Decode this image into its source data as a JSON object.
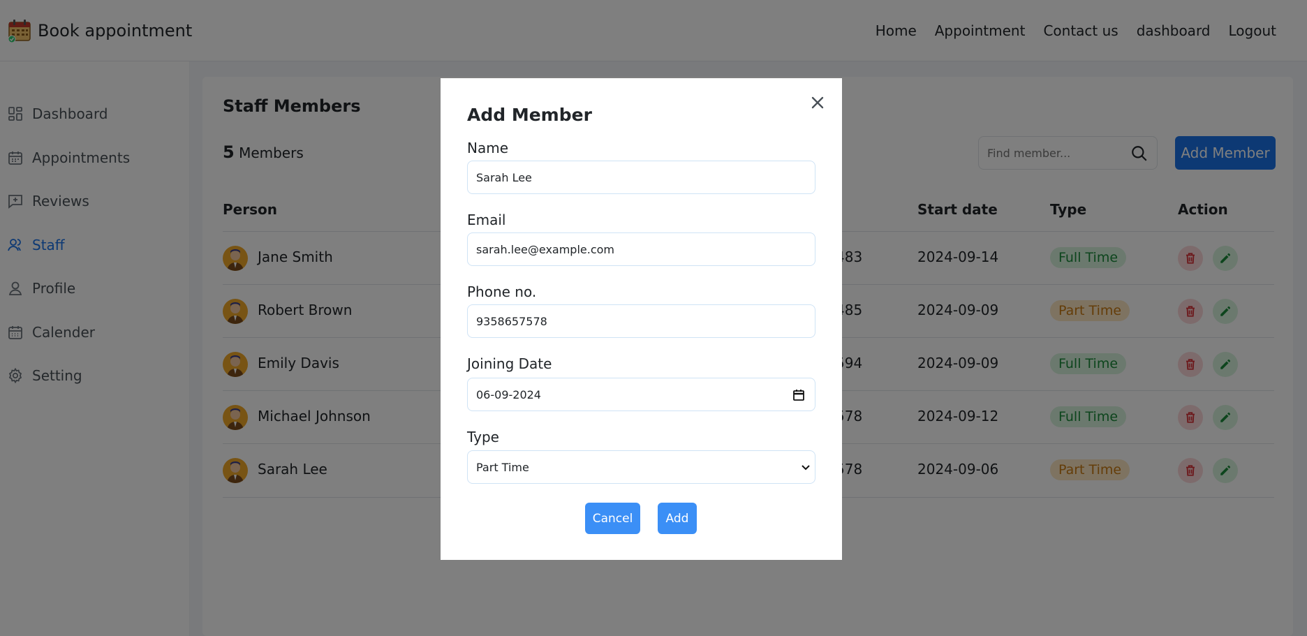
{
  "app": {
    "title": "Book appointment"
  },
  "nav": [
    "Home",
    "Appointment",
    "Contact us",
    "dashboard",
    "Logout"
  ],
  "sidebar": {
    "items": [
      {
        "label": "Dashboard",
        "icon": "dashboard-icon"
      },
      {
        "label": "Appointments",
        "icon": "calendar-icon"
      },
      {
        "label": "Reviews",
        "icon": "review-icon"
      },
      {
        "label": "Staff",
        "icon": "staff-icon",
        "active": true
      },
      {
        "label": "Profile",
        "icon": "user-icon"
      },
      {
        "label": "Calender",
        "icon": "calendar-grid-icon"
      },
      {
        "label": "Setting",
        "icon": "gear-icon"
      }
    ]
  },
  "page": {
    "title": "Staff Members",
    "count": "5",
    "count_label": "Members",
    "search_placeholder": "Find member...",
    "add_button": "Add Member"
  },
  "table": {
    "headers": {
      "person": "Person",
      "phone_partial": ".",
      "start": "Start date",
      "type": "Type",
      "action": "Action"
    },
    "rows": [
      {
        "name": "Jane Smith",
        "phone_tail": "483",
        "start": "2024-09-14",
        "type": "Full Time"
      },
      {
        "name": "Robert Brown",
        "phone_tail": "485",
        "start": "2024-09-09",
        "type": "Part Time"
      },
      {
        "name": "Emily Davis",
        "phone_tail": "594",
        "start": "2024-09-09",
        "type": "Full Time"
      },
      {
        "name": "Michael Johnson",
        "phone_tail": "578",
        "start": "2024-09-12",
        "type": "Full Time"
      },
      {
        "name": "Sarah Lee",
        "phone_tail": "578",
        "start": "2024-09-06",
        "type": "Part Time"
      }
    ]
  },
  "modal": {
    "title": "Add Member",
    "fields": {
      "name_label": "Name",
      "name_value": "Sarah Lee",
      "email_label": "Email",
      "email_value": "sarah.lee@example.com",
      "phone_label": "Phone no.",
      "phone_value": "9358657578",
      "date_label": "Joining Date",
      "date_value": "06-09-2024",
      "type_label": "Type",
      "type_value": "Part Time"
    },
    "cancel": "Cancel",
    "add": "Add"
  },
  "colors": {
    "accent": "#1a73e8",
    "modal_button": "#3b8ff6",
    "full_time_bg": "#d6f2dc",
    "full_time_text": "#1a8a3a",
    "part_time_bg": "#fde6c3",
    "part_time_text": "#c97a12",
    "delete": "#d93036",
    "edit": "#1a8a3a"
  }
}
